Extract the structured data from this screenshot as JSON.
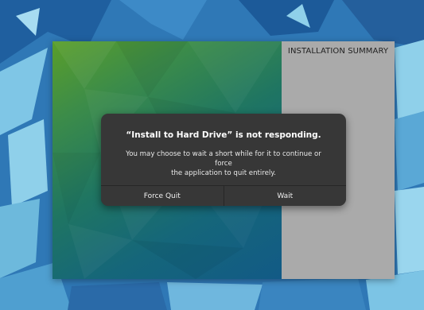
{
  "window": {
    "summary_title": "INSTALLATION SUMMARY"
  },
  "dialog": {
    "title": "“Install to Hard Drive” is not responding.",
    "message_line1": "You may choose to wait a short while for it to continue or force",
    "message_line2": "the application to quit entirely.",
    "force_quit_label": "Force Quit",
    "wait_label": "Wait"
  },
  "colors": {
    "desktop_base": "#2f78b6",
    "sidebar_start": "#5a9e2a",
    "sidebar_end": "#125a86",
    "main_pane": "#aaaaaa",
    "dialog_bg": "#373737"
  }
}
